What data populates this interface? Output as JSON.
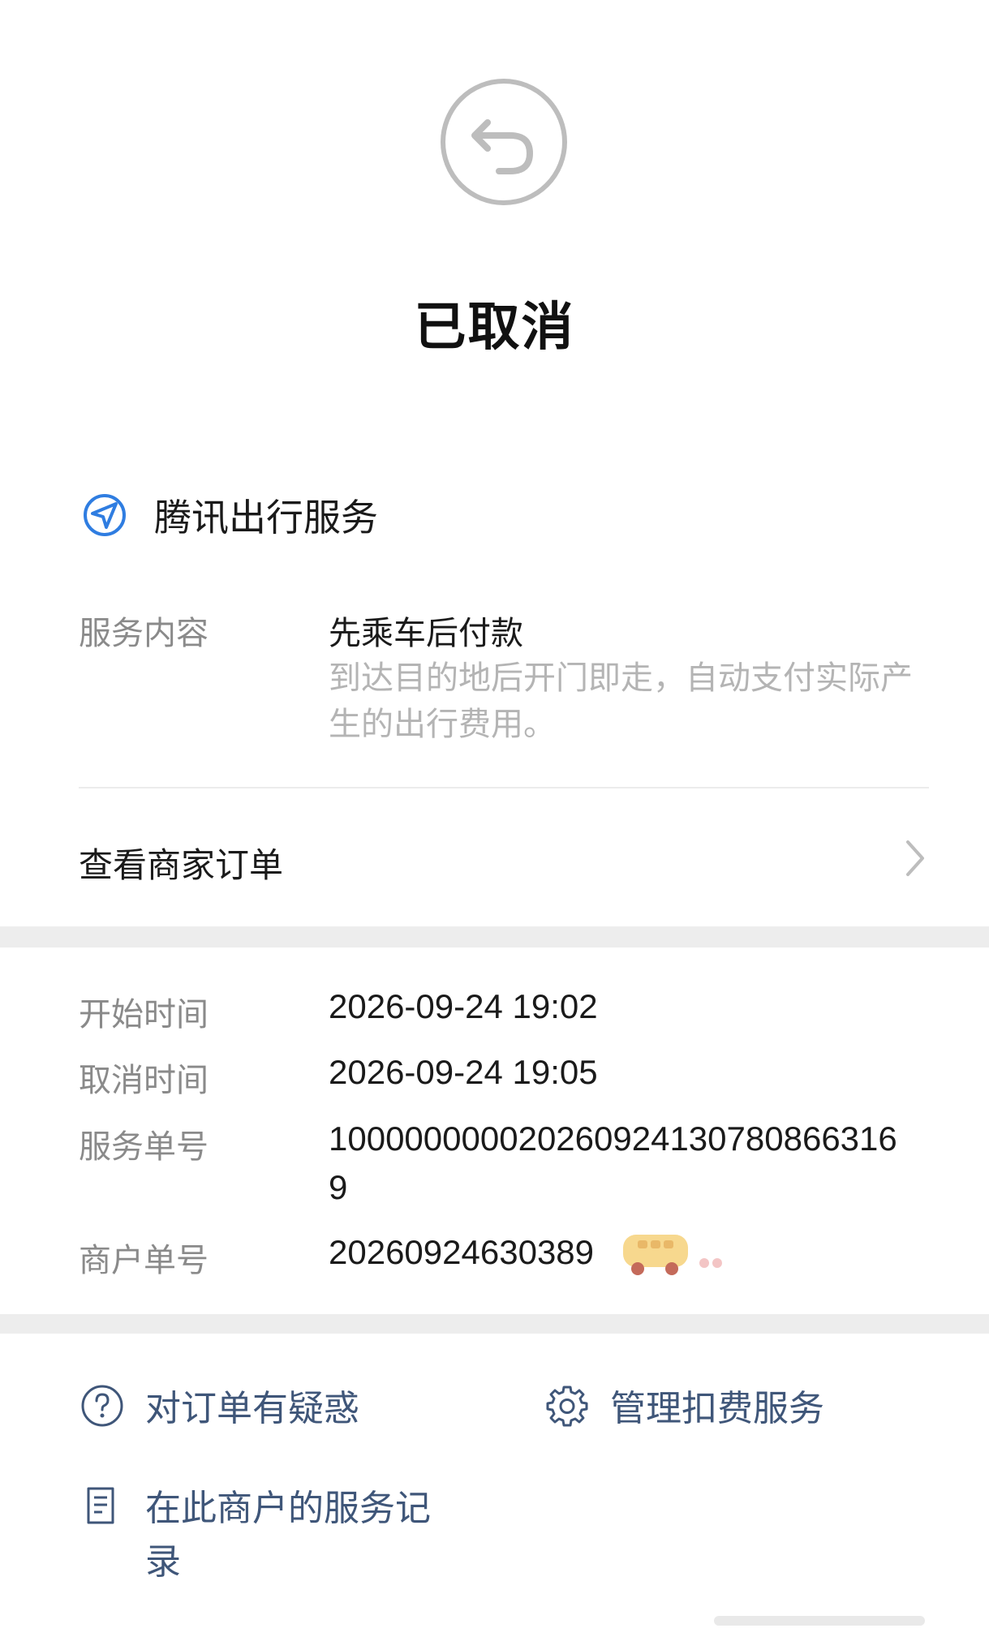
{
  "status": {
    "title": "已取消",
    "icon": "undo-arrow-icon"
  },
  "merchant": {
    "name": "腾讯出行服务",
    "icon": "navigation-arrow-icon",
    "icon_color": "#2f7de1"
  },
  "service": {
    "label": "服务内容",
    "name": "先乘车后付款",
    "description": "到达目的地后开门即走，自动支付实际产生的出行费用。"
  },
  "order_link": {
    "label": "查看商家订单"
  },
  "details": [
    {
      "label": "开始时间",
      "value": "2026-09-24 19:02"
    },
    {
      "label": "取消时间",
      "value": "2026-09-24 19:05"
    },
    {
      "label": "服务单号",
      "value": "100000000020260924130780866316",
      "value_line2": "9"
    },
    {
      "label": "商户单号",
      "value": "20260924630389"
    }
  ],
  "actions": {
    "doubt": "对订单有疑惑",
    "manage": "管理扣费服务",
    "records": "在此商户的服务记录"
  },
  "colors": {
    "accent": "#3f5679",
    "band": "#ededed",
    "secondary_text": "#8a8a8a"
  }
}
